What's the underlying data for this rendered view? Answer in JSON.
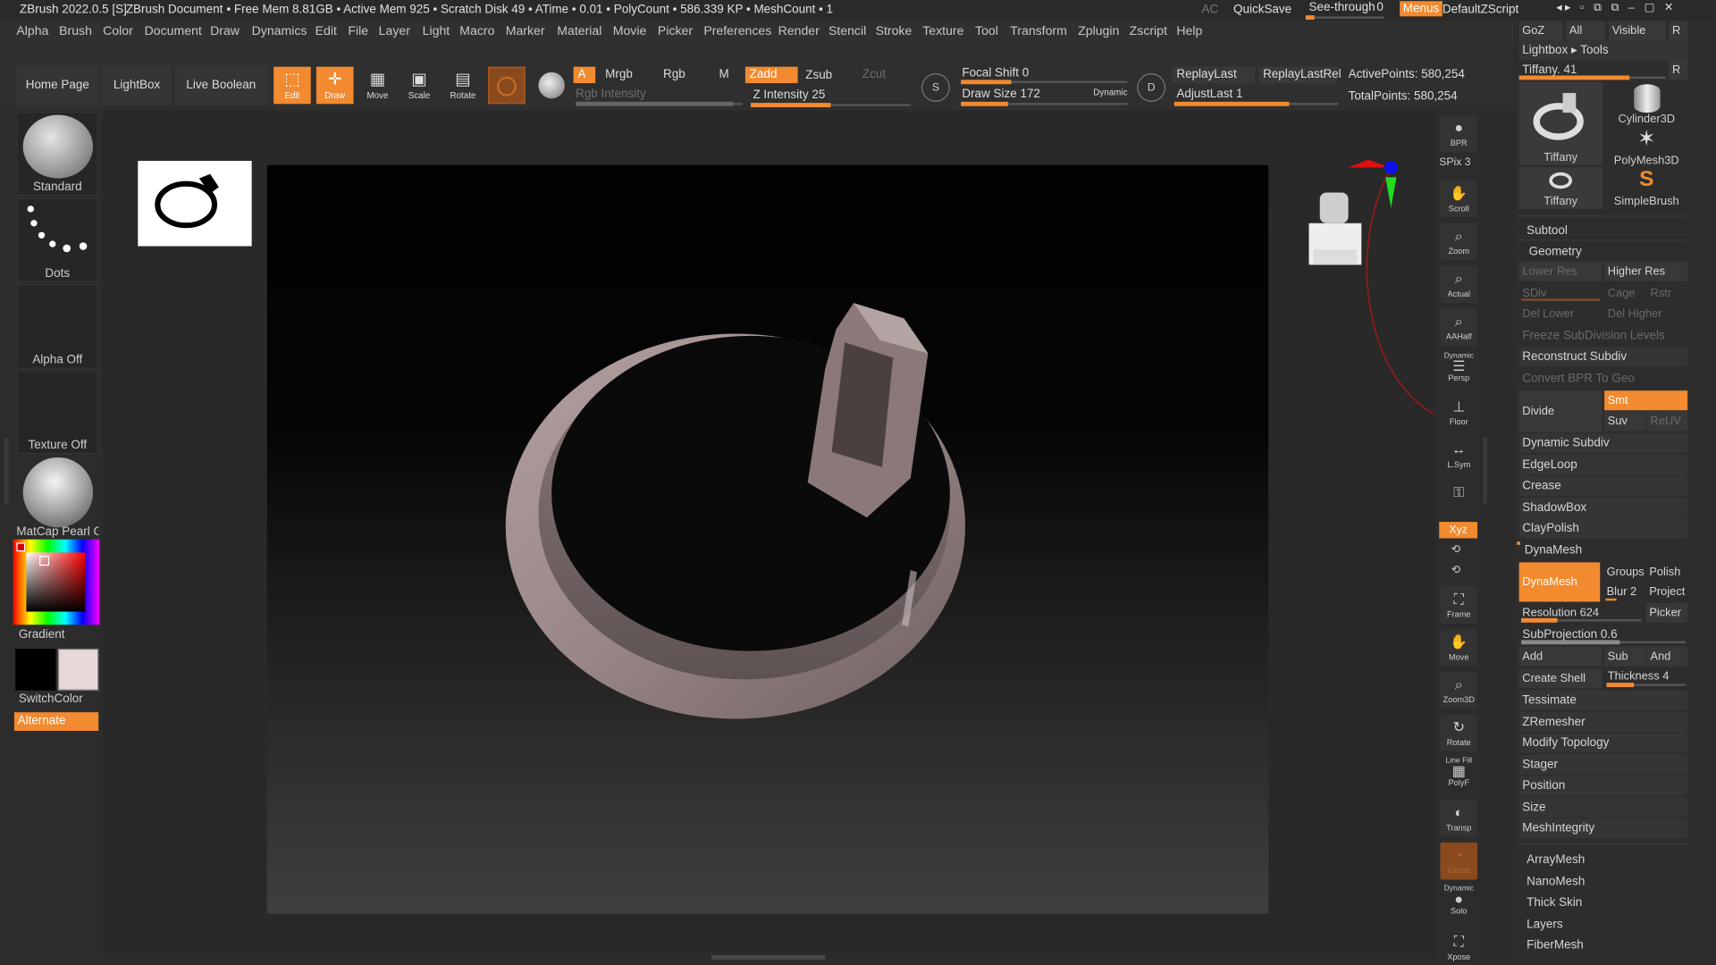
{
  "title": {
    "app": "ZBrush 2022.0.5 [S]",
    "doc": "ZBrush Document",
    "mem": "• Free Mem 8.81GB • Active Mem 925 • Scratch Disk 49 • ATime • 0.01 • PolyCount • 586.339 KP • MeshCount • 1",
    "ac": "AC",
    "quicksave": "QuickSave",
    "seethrough": "See-through",
    "seethrough_value": "0",
    "menus": "Menus",
    "script": "DefaultZScript"
  },
  "menu": [
    "Alpha",
    "Brush",
    "Color",
    "Document",
    "Draw",
    "Dynamics",
    "Edit",
    "File",
    "Layer",
    "Light",
    "Macro",
    "Marker",
    "Material",
    "Movie",
    "Picker",
    "Preferences",
    "Render",
    "Stencil",
    "Stroke",
    "Texture",
    "Tool",
    "Transform",
    "Zplugin",
    "Zscript",
    "Help"
  ],
  "shelf": {
    "tabs": [
      "Home Page",
      "LightBox",
      "Live Boolean"
    ],
    "modes": [
      "Edit",
      "Draw",
      "Move",
      "Scale",
      "Rotate"
    ],
    "a": "A",
    "mrgb": "Mrgb",
    "rgb": "Rgb",
    "m": "M",
    "rgb_intensity": "Rgb Intensity",
    "zadd": "Zadd",
    "zsub": "Zsub",
    "zcut": "Zcut",
    "z_intensity": "Z Intensity 25",
    "focal_shift": "Focal Shift 0",
    "draw_size": "Draw Size 172",
    "dynamic": "Dynamic",
    "replay_last": "ReplayLast",
    "replay_last_rel": "ReplayLastRel",
    "adjust_last": "AdjustLast 1",
    "active_points": "ActivePoints: 580,254",
    "total_points": "TotalPoints: 580,254",
    "s": "S",
    "d": "D",
    "levels": {
      "rgb_intensity": 0.95,
      "z_intensity": 0.5,
      "focal_shift": 0.3,
      "draw_size": 0.28,
      "adjust_last": 0.7
    }
  },
  "left": {
    "standard": "Standard",
    "dots": "Dots",
    "alpha_off": "Alpha Off",
    "texture_off": "Texture Off",
    "matcap": "MatCap Pearl Ca",
    "gradient": "Gradient",
    "switchcolor": "SwitchColor",
    "alternate": "Alternate"
  },
  "right_shelf": {
    "bpr": "BPR",
    "spix": "SPix 3",
    "scroll": "Scroll",
    "zoom": "Zoom",
    "actual": "Actual",
    "aahalf": "AAHalf",
    "dynamic": "Dynamic",
    "persp": "Persp",
    "floor": "Floor",
    "lsym": "L.Sym",
    "xyz": "Xyz",
    "frame": "Frame",
    "move": "Move",
    "zoom3d": "Zoom3D",
    "rotate": "Rotate",
    "line_fill": "Line Fill",
    "polyf": "PolyF",
    "transp": "Transp",
    "ghost": "Ghost",
    "dynamic2": "Dynamic",
    "solo": "Solo",
    "xpose": "Xpose"
  },
  "panel": {
    "goz": "GoZ",
    "all": "All",
    "visible": "Visible",
    "r": "R",
    "lightbox_tools": "Lightbox ▸ Tools",
    "tiffany": "Tiffany. 41",
    "tools": [
      "Tiffany",
      "Cylinder3D",
      "PolyMesh3D",
      "Tiffany",
      "SimpleBrush"
    ],
    "subtool": "Subtool",
    "geometry": "Geometry",
    "lower_res": "Lower Res",
    "higher_res": "Higher Res",
    "sdiv": "SDiv",
    "cage": "Cage",
    "rstr": "Rstr",
    "del_lower": "Del Lower",
    "del_higher": "Del Higher",
    "freeze": "Freeze SubDivision Levels",
    "reconstruct": "Reconstruct Subdiv",
    "convert_bpr": "Convert BPR To Geo",
    "divide": "Divide",
    "smt": "Smt",
    "suv": "Suv",
    "reuv": "ReUV",
    "items1": [
      "Dynamic Subdiv",
      "EdgeLoop",
      "Crease",
      "ShadowBox",
      "ClayPolish"
    ],
    "dynamesh_header": "DynaMesh",
    "dynamesh_btn": "DynaMesh",
    "groups": "Groups",
    "polish": "Polish",
    "blur": "Blur 2",
    "project": "Project",
    "resolution": "Resolution 624",
    "picker": "Picker",
    "subprojection": "SubProjection 0.6",
    "add": "Add",
    "sub": "Sub",
    "and": "And",
    "create_shell": "Create Shell",
    "thickness": "Thickness 4",
    "items2": [
      "Tessimate",
      "ZRemesher",
      "Modify Topology",
      "Stager",
      "Position",
      "Size",
      "MeshIntegrity"
    ],
    "items3": [
      "ArrayMesh",
      "NanoMesh",
      "Thick Skin",
      "Layers",
      "FiberMesh"
    ],
    "levels": {
      "tiffany": 0.75,
      "resolution": 0.3,
      "subprojection": 0.6,
      "thickness": 0.35
    }
  },
  "colors": {
    "accent": "#f28a30",
    "ring": "#9a8686",
    "bg": "#2b2b2b"
  }
}
